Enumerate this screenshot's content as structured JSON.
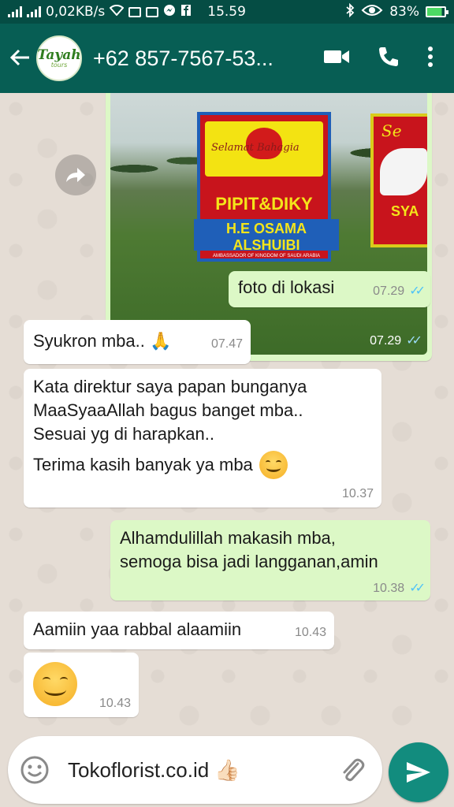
{
  "status_bar": {
    "network_speed": "0,02KB/s",
    "time": "15.59",
    "battery": "83%"
  },
  "header": {
    "avatar_brand": "Tayah",
    "avatar_brand_sub": "tours",
    "contact_name": "+62 857-7567-53...",
    "icons": [
      "back-arrow-icon",
      "video-call-icon",
      "phone-icon",
      "more-vert-icon"
    ]
  },
  "photo_message": {
    "time": "07.29",
    "ticks": "✓✓",
    "board_top_text": "Selamat Bahagia",
    "board_names": "PIPIT&DIKY",
    "board_sender": "H.E OSAMA ALSHUIBI",
    "board_sender_sub": "AMBASSADOR OF KINGDOM OF SAUDI ARABIA",
    "second_board_top": "Se",
    "second_board_bottom": "SYA"
  },
  "messages": [
    {
      "dir": "out",
      "text": "foto di lokasi",
      "time": "07.29",
      "ticks": "✓✓"
    },
    {
      "dir": "in",
      "text": "Syukron mba..",
      "emoji": "🙏",
      "time": "07.47"
    },
    {
      "dir": "in",
      "lines": [
        "Kata direktur saya papan bunganya",
        "MaaSyaaAllah bagus banget mba..",
        "Sesuai yg di harapkan..",
        "Terima kasih banyak ya mba"
      ],
      "time": "10.37"
    },
    {
      "dir": "out",
      "lines": [
        "Alhamdulillah makasih mba,",
        "semoga bisa jadi langganan,amin"
      ],
      "time": "10.38",
      "ticks": "✓✓"
    },
    {
      "dir": "in",
      "text": "Aamiin yaa rabbal alaamiin",
      "time": "10.43"
    },
    {
      "dir": "in",
      "text": "",
      "time": "10.43"
    }
  ],
  "composer": {
    "value": "Tokoflorist.co.id",
    "thumb_emoji": "👍🏻"
  },
  "colors": {
    "status_bar": "#054d44",
    "app_bar": "#075e54",
    "outgoing": "#dcf8c6",
    "incoming": "#ffffff",
    "send_button": "#128c7e",
    "read_ticks": "#4fc3f7"
  }
}
